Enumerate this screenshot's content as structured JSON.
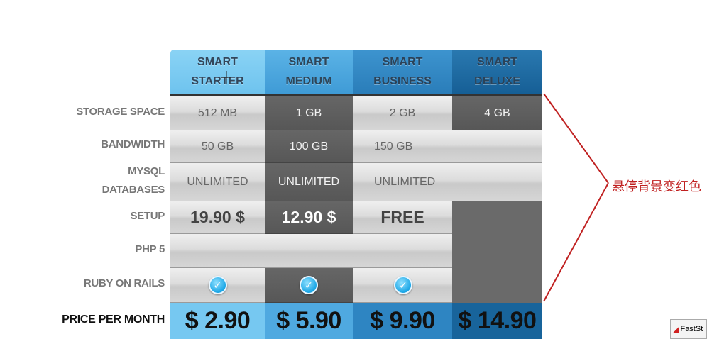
{
  "plans": [
    {
      "line1": "SMART",
      "line2": "STARTER",
      "price": "$ 2.90"
    },
    {
      "line1": "SMART",
      "line2": "MEDIUM",
      "price": "$ 5.90"
    },
    {
      "line1": "SMART",
      "line2": "BUSINESS",
      "price": "$ 9.90"
    },
    {
      "line1": "SMART",
      "line2": "DELUXE",
      "price": "$ 14.90"
    }
  ],
  "rows": {
    "storage": {
      "label": "STORAGE SPACE",
      "values": [
        "512 MB",
        "1 GB",
        "2 GB",
        "4 GB"
      ]
    },
    "bandwidth": {
      "label": "BANDWIDTH",
      "values": [
        "50 GB",
        "100 GB",
        "150 GB"
      ]
    },
    "mysql": {
      "label1": "MYSQL",
      "label2": "DATABASES",
      "values": [
        "UNLIMITED",
        "UNLIMITED",
        "UNLIMITED"
      ]
    },
    "setup": {
      "label": "SETUP",
      "values": [
        "19.90 $",
        "12.90 $",
        "FREE"
      ]
    },
    "php": {
      "label": "PHP 5"
    },
    "ruby": {
      "label": "RUBY ON RAILS"
    },
    "price": {
      "label": "PRICE PER MONTH"
    }
  },
  "annotation": "悬停背景变红色",
  "faststone_label": "FastSt",
  "colors": {
    "annotation": "#c02020",
    "header1": "#76c8f1",
    "header2": "#4fa9e0",
    "header3": "#2e85c2",
    "header4": "#18649b",
    "dark_cell": "#5f5f5f"
  },
  "icons": {
    "check": "check-circle-icon",
    "cursor": "cursor-crosshair-icon"
  }
}
